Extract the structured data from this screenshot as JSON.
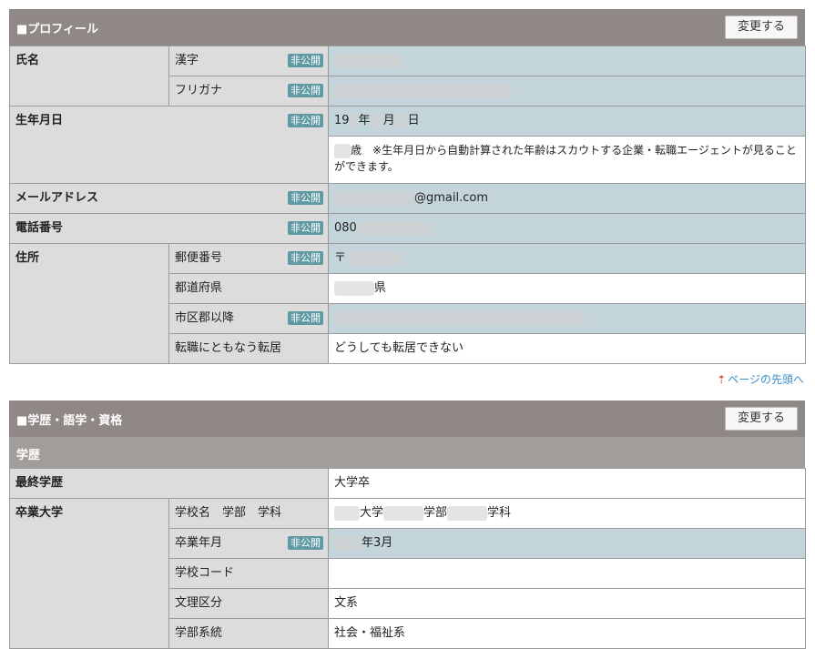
{
  "profile": {
    "title": "■プロフィール",
    "edit_button": "変更する",
    "private_badge": "非公開",
    "name": {
      "label": "氏名",
      "kanji_label": "漢字",
      "furigana_label": "フリガナ"
    },
    "birth": {
      "label": "生年月日",
      "date_prefix": "19",
      "year_suffix": "年",
      "month_suffix": "月",
      "day_suffix": "日",
      "age_suffix": "歳",
      "note": "※生年月日から自動計算された年齢はスカウトする企業・転職エージェントが見ることができます。"
    },
    "email": {
      "label": "メールアドレス",
      "domain": "@gmail.com"
    },
    "phone": {
      "label": "電話番号",
      "prefix": "080"
    },
    "address": {
      "label": "住所",
      "postal_label": "郵便番号",
      "postal_mark": "〒",
      "prefecture_label": "都道府県",
      "prefecture_suffix": "県",
      "city_label": "市区郡以降",
      "relocation_label": "転職にともなう転居",
      "relocation_value": "どうしても転居できない"
    }
  },
  "page_top_link": "ページの先頭へ",
  "education": {
    "title": "■学歴・語学・資格",
    "edit_button": "変更する",
    "sub_title": "学歴",
    "final_label": "最終学歴",
    "final_value": "大学卒",
    "grad_label": "卒業大学",
    "school_label": "学校名　学部　学科",
    "school_university": "大学",
    "school_faculty": "学部",
    "school_department": "学科",
    "grad_date_label": "卒業年月",
    "grad_date_value": "年3月",
    "school_code_label": "学校コード",
    "school_code_value": "",
    "field_label": "文理区分",
    "field_value": "文系",
    "faculty_type_label": "学部系統",
    "faculty_type_value": "社会・福祉系"
  }
}
